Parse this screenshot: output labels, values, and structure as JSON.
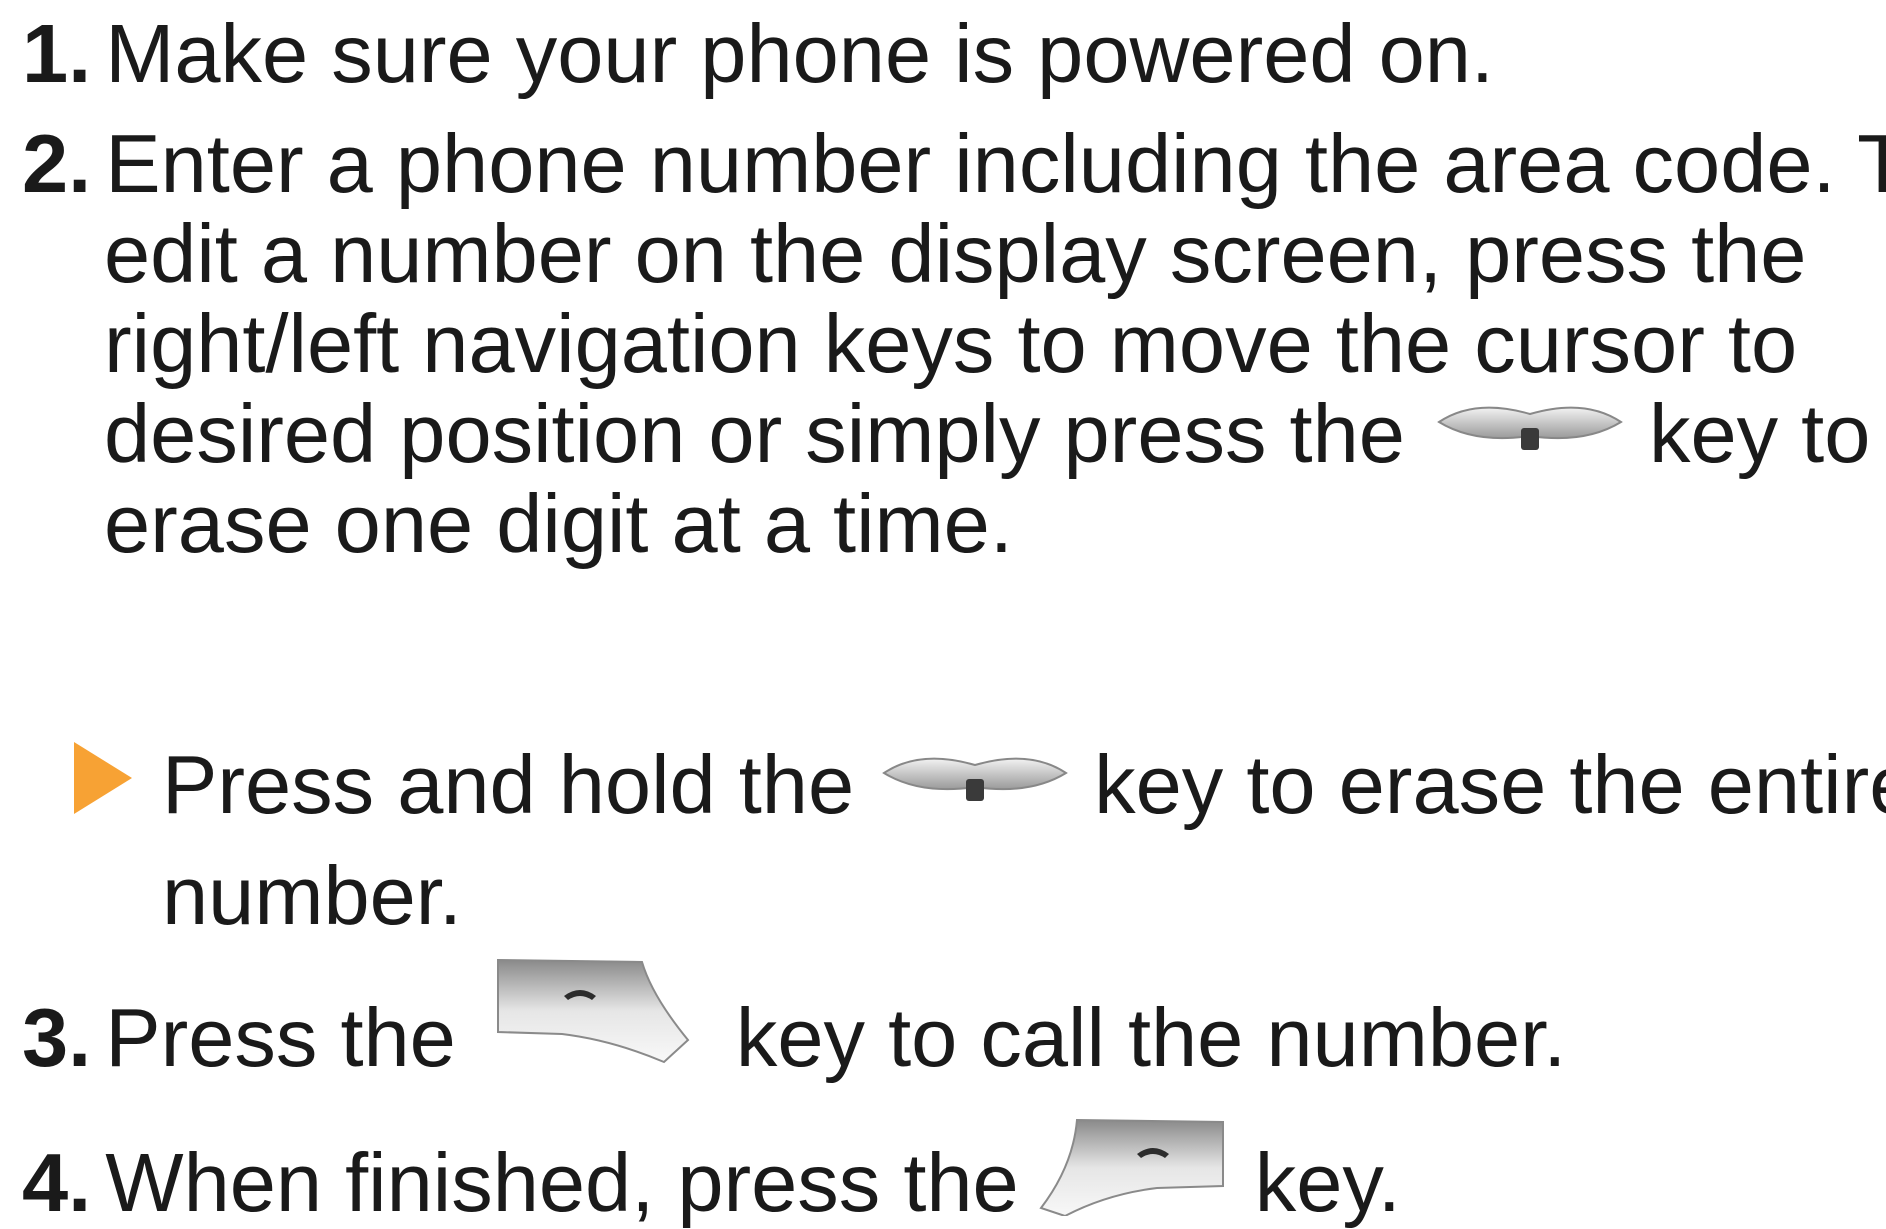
{
  "steps": [
    {
      "number": "1.",
      "lines": [
        "Make sure your phone is powered on."
      ]
    },
    {
      "number": "2.",
      "line1": "Enter a phone number including the area code. To",
      "line2": "edit a number on the display screen, press the",
      "line3": "right/left navigation keys to move the cursor to",
      "line4_before": "desired position or simply press the",
      "line4_after": "key to",
      "line5": "erase one digit at a time."
    }
  ],
  "bullet": {
    "before": "Press and hold the",
    "after": "key to erase the entire",
    "line2": "number."
  },
  "step3": {
    "number": "3.",
    "before": "Press the",
    "after": "key to call the number."
  },
  "step4": {
    "number": "4.",
    "before": "When finished, press the",
    "after": "key."
  },
  "icons": {
    "clear_key": "clear-key-icon",
    "send_key": "send-key-icon",
    "end_key": "end-key-icon",
    "bullet": "orange-triangle-bullet"
  },
  "colors": {
    "bullet": "#f7a234",
    "text": "#1a1a1a"
  }
}
